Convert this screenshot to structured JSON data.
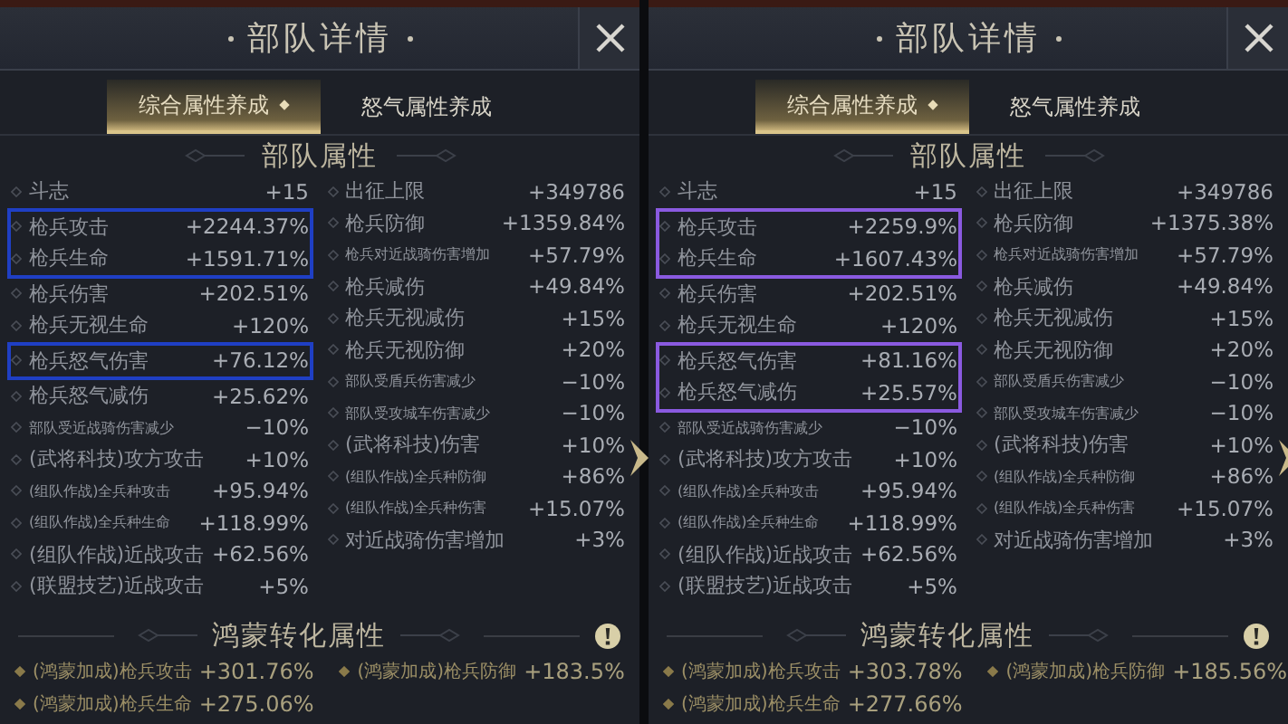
{
  "panels": [
    {
      "title": "部队详情",
      "color": "#1f3fc4",
      "tabs": [
        {
          "label": "综合属性养成",
          "selected": true
        },
        {
          "label": "怒气属性养成",
          "selected": false
        }
      ],
      "attributes": {
        "title": "部队属性",
        "left": [
          {
            "label": "斗志",
            "value": "+15",
            "highlighted": false,
            "compact": false
          },
          {
            "label": "枪兵攻击",
            "value": "+2244.37%",
            "highlighted": true,
            "compact": false
          },
          {
            "label": "枪兵生命",
            "value": "+1591.71%",
            "highlighted": true,
            "compact": false
          },
          {
            "label": "枪兵伤害",
            "value": "+202.51%",
            "highlighted": false,
            "compact": false
          },
          {
            "label": "枪兵无视生命",
            "value": "+120%",
            "highlighted": false,
            "compact": false
          },
          {
            "label": "枪兵怒气伤害",
            "value": "+76.12%",
            "highlighted": true,
            "compact": false
          },
          {
            "label": "枪兵怒气减伤",
            "value": "+25.62%",
            "highlighted": false,
            "compact": false
          },
          {
            "label": "部队受近战骑伤害减少",
            "value": "−10%",
            "highlighted": false,
            "compact": true
          },
          {
            "label": "(武将科技)攻方攻击",
            "value": "+10%",
            "highlighted": false,
            "compact": false
          },
          {
            "label": "(组队作战)全兵种攻击",
            "value": "+95.94%",
            "highlighted": false,
            "compact": true
          },
          {
            "label": "(组队作战)全兵种生命",
            "value": "+118.99%",
            "highlighted": false,
            "compact": true
          },
          {
            "label": "(组队作战)近战攻击",
            "value": "+62.56%",
            "highlighted": false,
            "compact": false
          },
          {
            "label": "(联盟技艺)近战攻击",
            "value": "+5%",
            "highlighted": false,
            "compact": false
          }
        ],
        "right": [
          {
            "label": "出征上限",
            "value": "+349786",
            "highlighted": false,
            "compact": false
          },
          {
            "label": "枪兵防御",
            "value": "+1359.84%",
            "highlighted": false,
            "compact": false
          },
          {
            "label": "枪兵对近战骑伤害增加",
            "value": "+57.79%",
            "highlighted": false,
            "compact": true
          },
          {
            "label": "枪兵减伤",
            "value": "+49.84%",
            "highlighted": false,
            "compact": false
          },
          {
            "label": "枪兵无视减伤",
            "value": "+15%",
            "highlighted": false,
            "compact": false
          },
          {
            "label": "枪兵无视防御",
            "value": "+20%",
            "highlighted": false,
            "compact": false
          },
          {
            "label": "部队受盾兵伤害减少",
            "value": "−10%",
            "highlighted": false,
            "compact": true
          },
          {
            "label": "部队受攻城车伤害减少",
            "value": "−10%",
            "highlighted": false,
            "compact": true
          },
          {
            "label": "(武将科技)伤害",
            "value": "+10%",
            "highlighted": false,
            "compact": false
          },
          {
            "label": "(组队作战)全兵种防御",
            "value": "+86%",
            "highlighted": false,
            "compact": true
          },
          {
            "label": "(组队作战)全兵种伤害",
            "value": "+15.07%",
            "highlighted": false,
            "compact": true
          },
          {
            "label": "对近战骑伤害增加",
            "value": "+3%",
            "highlighted": false,
            "compact": false
          }
        ]
      },
      "conversion": {
        "title": "鸿蒙转化属性",
        "items": [
          {
            "label": "(鸿蒙加成)枪兵攻击",
            "value": "+301.76%"
          },
          {
            "label": "(鸿蒙加成)枪兵防御",
            "value": "+183.5%"
          },
          {
            "label": "(鸿蒙加成)枪兵生命",
            "value": "+275.06%"
          }
        ]
      }
    },
    {
      "title": "部队详情",
      "color": "#8a5ae0",
      "tabs": [
        {
          "label": "综合属性养成",
          "selected": true
        },
        {
          "label": "怒气属性养成",
          "selected": false
        }
      ],
      "attributes": {
        "title": "部队属性",
        "left": [
          {
            "label": "斗志",
            "value": "+15",
            "highlighted": false,
            "compact": false
          },
          {
            "label": "枪兵攻击",
            "value": "+2259.9%",
            "highlighted": true,
            "compact": false
          },
          {
            "label": "枪兵生命",
            "value": "+1607.43%",
            "highlighted": true,
            "compact": false
          },
          {
            "label": "枪兵伤害",
            "value": "+202.51%",
            "highlighted": false,
            "compact": false
          },
          {
            "label": "枪兵无视生命",
            "value": "+120%",
            "highlighted": false,
            "compact": false
          },
          {
            "label": "枪兵怒气伤害",
            "value": "+81.16%",
            "highlighted": true,
            "compact": false
          },
          {
            "label": "枪兵怒气减伤",
            "value": "+25.57%",
            "highlighted": true,
            "compact": false
          },
          {
            "label": "部队受近战骑伤害减少",
            "value": "−10%",
            "highlighted": false,
            "compact": true
          },
          {
            "label": "(武将科技)攻方攻击",
            "value": "+10%",
            "highlighted": false,
            "compact": false
          },
          {
            "label": "(组队作战)全兵种攻击",
            "value": "+95.94%",
            "highlighted": false,
            "compact": true
          },
          {
            "label": "(组队作战)全兵种生命",
            "value": "+118.99%",
            "highlighted": false,
            "compact": true
          },
          {
            "label": "(组队作战)近战攻击",
            "value": "+62.56%",
            "highlighted": false,
            "compact": false
          },
          {
            "label": "(联盟技艺)近战攻击",
            "value": "+5%",
            "highlighted": false,
            "compact": false
          }
        ],
        "right": [
          {
            "label": "出征上限",
            "value": "+349786",
            "highlighted": false,
            "compact": false
          },
          {
            "label": "枪兵防御",
            "value": "+1375.38%",
            "highlighted": false,
            "compact": false
          },
          {
            "label": "枪兵对近战骑伤害增加",
            "value": "+57.79%",
            "highlighted": false,
            "compact": true
          },
          {
            "label": "枪兵减伤",
            "value": "+49.84%",
            "highlighted": false,
            "compact": false
          },
          {
            "label": "枪兵无视减伤",
            "value": "+15%",
            "highlighted": false,
            "compact": false
          },
          {
            "label": "枪兵无视防御",
            "value": "+20%",
            "highlighted": false,
            "compact": false
          },
          {
            "label": "部队受盾兵伤害减少",
            "value": "−10%",
            "highlighted": false,
            "compact": true
          },
          {
            "label": "部队受攻城车伤害减少",
            "value": "−10%",
            "highlighted": false,
            "compact": true
          },
          {
            "label": "(武将科技)伤害",
            "value": "+10%",
            "highlighted": false,
            "compact": false
          },
          {
            "label": "(组队作战)全兵种防御",
            "value": "+86%",
            "highlighted": false,
            "compact": true
          },
          {
            "label": "(组队作战)全兵种伤害",
            "value": "+15.07%",
            "highlighted": false,
            "compact": true
          },
          {
            "label": "对近战骑伤害增加",
            "value": "+3%",
            "highlighted": false,
            "compact": false
          }
        ]
      },
      "conversion": {
        "title": "鸿蒙转化属性",
        "items": [
          {
            "label": "(鸿蒙加成)枪兵攻击",
            "value": "+303.78%"
          },
          {
            "label": "(鸿蒙加成)枪兵防御",
            "value": "+185.56%"
          },
          {
            "label": "(鸿蒙加成)枪兵生命",
            "value": "+277.66%"
          }
        ]
      }
    }
  ]
}
